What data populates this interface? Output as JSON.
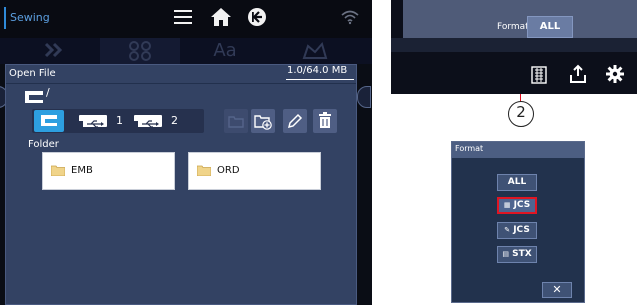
{
  "app": {
    "title": "Sewing"
  },
  "tabs": [
    {
      "icon": "embroidery-pattern-icon"
    },
    {
      "icon": "pattern-grid-icon"
    },
    {
      "label": "Aa"
    },
    {
      "icon": "crown-edit-icon"
    }
  ],
  "open_file_dialog": {
    "title": "Open File",
    "memory": "1.0/64.0 MB",
    "path": "/",
    "devices": [
      {
        "type": "machine",
        "label": ""
      },
      {
        "type": "usb",
        "label": "1"
      },
      {
        "type": "usb",
        "label": "2"
      }
    ],
    "tools": [
      "move-folder-icon",
      "new-folder-icon",
      "rename-icon",
      "delete-icon"
    ],
    "folder_section_label": "Folder",
    "folders": [
      "EMB",
      "ORD"
    ]
  },
  "format_bar": {
    "label": "Format",
    "value": "ALL"
  },
  "callout": {
    "number": "2",
    "color": "#e10d1d"
  },
  "format_dialog": {
    "title": "Format",
    "options": [
      {
        "label": "ALL",
        "prefix": "",
        "selected": false
      },
      {
        "label": "JCS",
        "prefix": "▦",
        "selected": true
      },
      {
        "label": "JCS",
        "prefix": "✎",
        "selected": false
      },
      {
        "label": "STX",
        "prefix": "▤",
        "selected": false
      }
    ],
    "close_label": "✕"
  },
  "colors": {
    "accent": "#2d9fe0",
    "dialog": "#334263",
    "highlight": "#e01523"
  }
}
